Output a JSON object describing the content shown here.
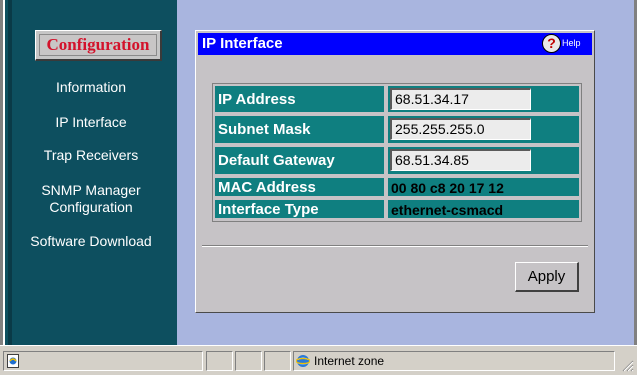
{
  "sidebar": {
    "config_label": "Configuration",
    "items": [
      {
        "label": "Information"
      },
      {
        "label": "IP Interface"
      },
      {
        "label": "Trap Receivers"
      },
      {
        "label_line1": "SNMP Manager",
        "label_line2": "Configuration"
      },
      {
        "label": "Software Download"
      }
    ]
  },
  "panel": {
    "title": "IP Interface",
    "help_label": "Help",
    "help_icon_glyph": "?",
    "fields": [
      {
        "label": "IP Address",
        "value": "68.51.34.17",
        "editable": true
      },
      {
        "label": "Subnet Mask",
        "value": "255.255.255.0",
        "editable": true
      },
      {
        "label": "Default Gateway",
        "value": "68.51.34.85",
        "editable": true
      },
      {
        "label": "MAC Address",
        "value": "00 80 c8 20 17 12",
        "editable": false
      },
      {
        "label": "Interface Type",
        "value": "ethernet-csmacd",
        "editable": false
      }
    ],
    "apply_label": "Apply"
  },
  "statusbar": {
    "zone_text": "Internet zone"
  },
  "colors": {
    "sidebar_bg": "#0d4f5f",
    "main_bg": "#a9b5df",
    "title_bar": "#0000ff",
    "label_cell": "#0f7f80",
    "config_text": "#d3122b"
  }
}
